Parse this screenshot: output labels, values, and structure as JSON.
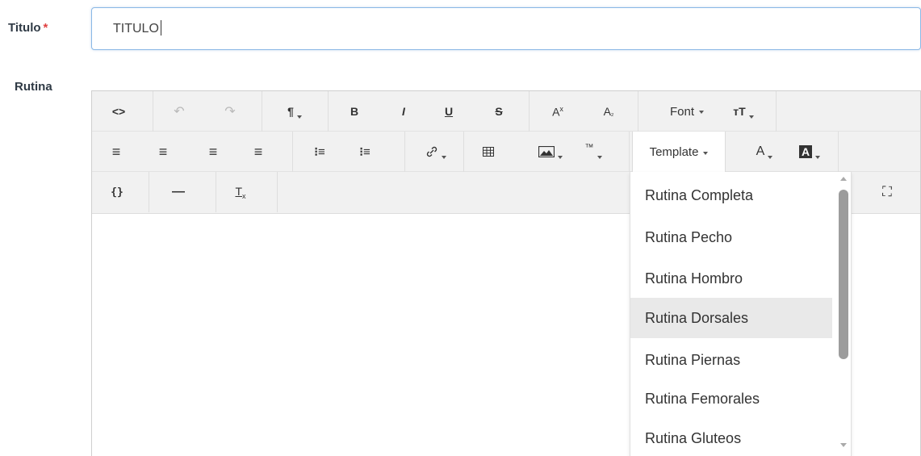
{
  "form": {
    "title_label": "Titulo",
    "required_mark": "*",
    "title_value": "TITULO",
    "routine_label": "Rutina"
  },
  "toolbar": {
    "row1": {
      "code_view": "<>",
      "undo": "↶",
      "redo": "↷",
      "paragraph": "¶",
      "bold": "B",
      "italic": "I",
      "underline": "U",
      "strikethrough": "S",
      "superscript": "A",
      "superscript_mark": "x",
      "subscript": "A",
      "subscript_mark": "₂",
      "font_label": "Font",
      "font_size": "тT"
    },
    "row2": {
      "align_left": "≡",
      "align_center": "≡",
      "align_right": "≡",
      "justify": "≡",
      "unordered_list": "⁝≡",
      "ordered_list": "⁝≡",
      "link": "🔗",
      "table": "▦",
      "image": "🖼",
      "special_chars": "™",
      "template_label": "Template",
      "font_color": "A",
      "background_color": "A"
    },
    "row3": {
      "code_block": "{}",
      "horizontal_rule": "—",
      "clear_format": "T",
      "clear_format_mark": "x",
      "fullscreen": "⛶"
    }
  },
  "template_dropdown": {
    "items": [
      "Rutina Completa",
      "Rutina Pecho",
      "Rutina Hombro",
      "Rutina Dorsales",
      "Rutina Piernas",
      "Rutina Femorales",
      "Rutina Gluteos"
    ],
    "highlighted": "Rutina Dorsales"
  },
  "colors": {
    "input_border": "#8ab8e6",
    "required": "#e04040",
    "toolbar_bg": "#f1f1f1",
    "highlight": "#e9e9e9"
  }
}
